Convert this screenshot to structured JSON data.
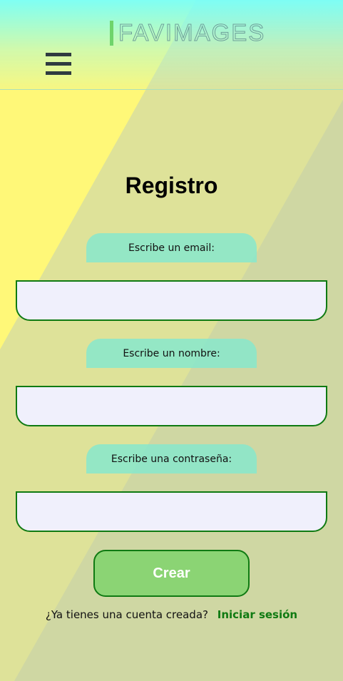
{
  "header": {
    "logo_text": "FAVIMAGES"
  },
  "form": {
    "title": "Registro",
    "email_label": "Escribe un email:",
    "email_value": "",
    "name_label": "Escribe un nombre:",
    "name_value": "",
    "password_label": "Escribe una contraseña:",
    "password_value": "",
    "submit_label": "Crear"
  },
  "footer": {
    "question": "¿Ya tienes una cuenta creada?",
    "login_link": "Iniciar sesión"
  },
  "colors": {
    "accent_green": "#0f7a12",
    "button_fill": "#8bd474",
    "label_tab": "#87e8cd",
    "input_fill": "#f0f0fc"
  }
}
